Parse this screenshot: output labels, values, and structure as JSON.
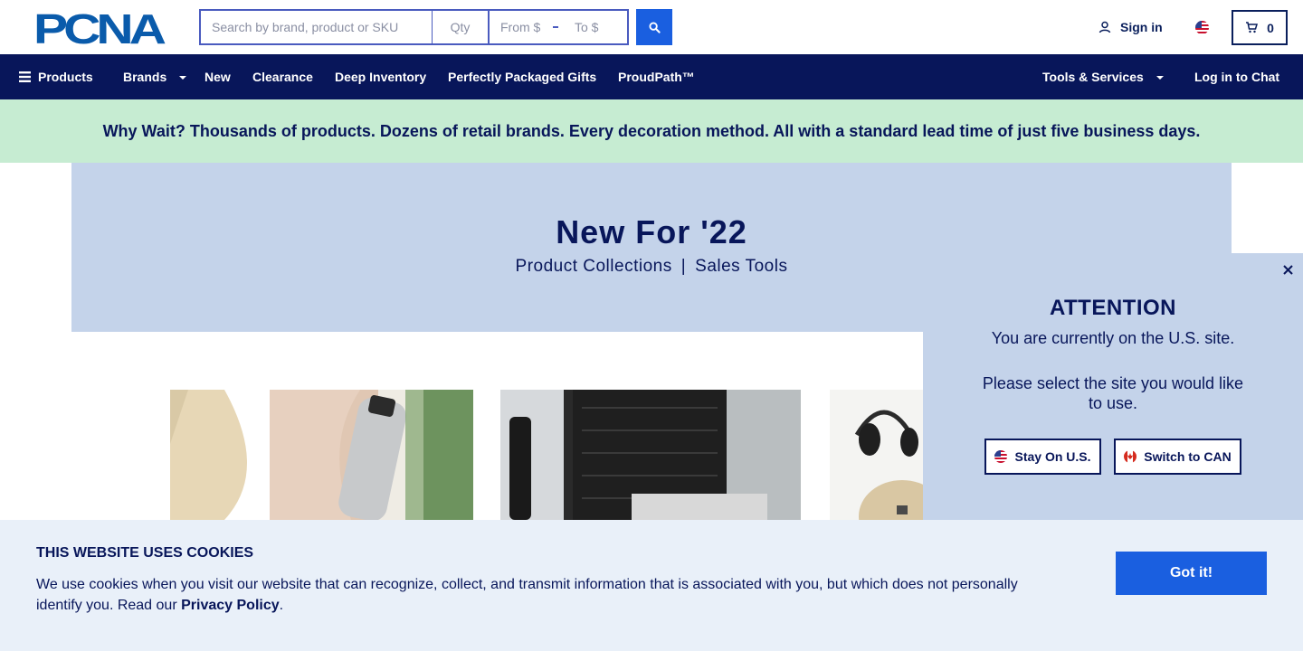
{
  "header": {
    "logo_text": "PCNA",
    "search": {
      "placeholder": "Search by brand, product or SKU",
      "qty_placeholder": "Qty",
      "price_from_placeholder": "From $",
      "price_to_placeholder": "To $"
    },
    "sign_in_label": "Sign in",
    "cart_count": "0"
  },
  "nav": {
    "items": [
      {
        "label": "Products"
      },
      {
        "label": "Brands"
      },
      {
        "label": "New"
      },
      {
        "label": "Clearance"
      },
      {
        "label": "Deep Inventory"
      },
      {
        "label": "Perfectly Packaged Gifts"
      },
      {
        "label": "ProudPath™"
      }
    ],
    "tools_label": "Tools & Services",
    "chat_label": "Log in to Chat"
  },
  "promo": {
    "text": "Why Wait? Thousands of products. Dozens of retail brands. Every decoration method. All with a standard lead time of just five business days."
  },
  "hero": {
    "title": "New For '22",
    "sub_left": "Product Collections",
    "sub_sep": "|",
    "sub_right": "Sales Tools"
  },
  "attention": {
    "title": "ATTENTION",
    "line1": "You are currently on the U.S. site.",
    "line2": "Please select the site you would like to use.",
    "stay_label": "Stay On U.S.",
    "switch_label": "Switch to CAN"
  },
  "cookie": {
    "title": "THIS WEBSITE USES COOKIES",
    "text": "We use cookies when you visit our website that can recognize, collect, and transmit information that is associated with you, but which does not personally identify you. Read our",
    "link_label": "Privacy Policy",
    "text_end": ".",
    "button_label": "Got it!"
  },
  "colors": {
    "navy": "#08165a",
    "accent_blue": "#1a5fe0",
    "promo_green": "#c6ecd2",
    "hero_blue": "#c4d3ea",
    "cookie_bg": "#e9f0f9"
  },
  "icons": [
    "menu-icon",
    "search-icon",
    "user-icon",
    "us-flag-icon",
    "cart-icon",
    "close-icon",
    "canada-flag-icon"
  ]
}
